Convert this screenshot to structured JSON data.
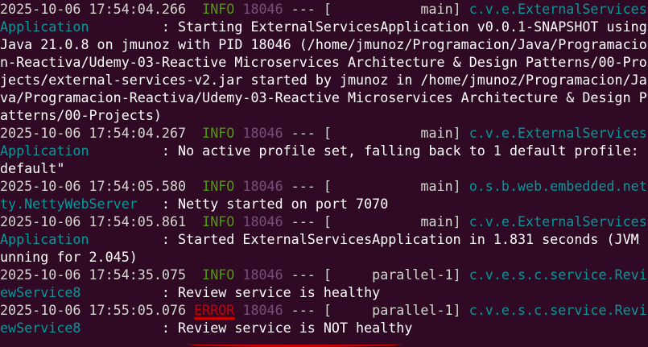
{
  "terminal": {
    "lines": [
      {
        "segments": [
          {
            "cls": "ts",
            "text": "2025-10-06 17:54:04.266  "
          },
          {
            "cls": "lvl-info",
            "text": "INFO "
          },
          {
            "cls": "pid",
            "text": "18046"
          },
          {
            "cls": "dim",
            "text": " --- [           "
          },
          {
            "cls": "thread",
            "text": "main] "
          },
          {
            "cls": "logger",
            "text": "c.v.e.ExternalServices"
          }
        ]
      },
      {
        "segments": [
          {
            "cls": "logger",
            "text": "Application        "
          },
          {
            "cls": "msg",
            "text": " : Starting ExternalServicesApplication v0.0.1-SNAPSHOT using"
          }
        ]
      },
      {
        "segments": [
          {
            "cls": "msg",
            "text": "Java 21.0.8 on jmunoz with PID 18046 (/home/jmunoz/Programacion/Java/Programacio"
          }
        ]
      },
      {
        "segments": [
          {
            "cls": "msg",
            "text": "n-Reactiva/Udemy-03-Reactive Microservices Architecture & Design Patterns/00-Pro"
          }
        ]
      },
      {
        "segments": [
          {
            "cls": "msg",
            "text": "jects/external-services-v2.jar started by jmunoz in /home/jmunoz/Programacion/Ja"
          }
        ]
      },
      {
        "segments": [
          {
            "cls": "msg",
            "text": "va/Programacion-Reactiva/Udemy-03-Reactive Microservices Architecture & Design P"
          }
        ]
      },
      {
        "segments": [
          {
            "cls": "msg",
            "text": "atterns/00-Projects)"
          }
        ]
      },
      {
        "segments": [
          {
            "cls": "ts",
            "text": "2025-10-06 17:54:04.267  "
          },
          {
            "cls": "lvl-info",
            "text": "INFO "
          },
          {
            "cls": "pid",
            "text": "18046"
          },
          {
            "cls": "dim",
            "text": " --- [           "
          },
          {
            "cls": "thread",
            "text": "main] "
          },
          {
            "cls": "logger",
            "text": "c.v.e.ExternalServices"
          }
        ]
      },
      {
        "segments": [
          {
            "cls": "logger",
            "text": "Application        "
          },
          {
            "cls": "msg",
            "text": " : No active profile set, falling back to 1 default profile: \""
          }
        ]
      },
      {
        "segments": [
          {
            "cls": "msg",
            "text": "default\""
          }
        ]
      },
      {
        "segments": [
          {
            "cls": "ts",
            "text": "2025-10-06 17:54:05.580  "
          },
          {
            "cls": "lvl-info",
            "text": "INFO "
          },
          {
            "cls": "pid",
            "text": "18046"
          },
          {
            "cls": "dim",
            "text": " --- [           "
          },
          {
            "cls": "thread",
            "text": "main] "
          },
          {
            "cls": "logger",
            "text": "o.s.b.web.embedded.net"
          }
        ]
      },
      {
        "segments": [
          {
            "cls": "logger",
            "text": "ty.NettyWebServer  "
          },
          {
            "cls": "msg",
            "text": " : Netty started on port 7070"
          }
        ]
      },
      {
        "segments": [
          {
            "cls": "ts",
            "text": "2025-10-06 17:54:05.861  "
          },
          {
            "cls": "lvl-info",
            "text": "INFO "
          },
          {
            "cls": "pid",
            "text": "18046"
          },
          {
            "cls": "dim",
            "text": " --- [           "
          },
          {
            "cls": "thread",
            "text": "main] "
          },
          {
            "cls": "logger",
            "text": "c.v.e.ExternalServices"
          }
        ]
      },
      {
        "segments": [
          {
            "cls": "logger",
            "text": "Application        "
          },
          {
            "cls": "msg",
            "text": " : Started ExternalServicesApplication in 1.831 seconds (JVM r"
          }
        ]
      },
      {
        "segments": [
          {
            "cls": "msg",
            "text": "unning for 2.045)"
          }
        ]
      },
      {
        "segments": [
          {
            "cls": "ts",
            "text": "2025-10-06 17:54:35.075  "
          },
          {
            "cls": "lvl-info",
            "text": "INFO "
          },
          {
            "cls": "pid",
            "text": "18046"
          },
          {
            "cls": "dim",
            "text": " --- [     "
          },
          {
            "cls": "thread",
            "text": "parallel-1] "
          },
          {
            "cls": "logger",
            "text": "c.v.e.s.c.service.Revi"
          }
        ]
      },
      {
        "segments": [
          {
            "cls": "logger",
            "text": "ewService8         "
          },
          {
            "cls": "msg",
            "text": " : Review service is healthy"
          }
        ]
      },
      {
        "segments": [
          {
            "cls": "ts",
            "text": "2025-10-06 17:55:05.076 "
          },
          {
            "cls": "lvl-error underline-red",
            "text": "ERROR"
          },
          {
            "cls": "dim",
            "text": " "
          },
          {
            "cls": "pid",
            "text": "18046"
          },
          {
            "cls": "dim",
            "text": " --- [     "
          },
          {
            "cls": "thread",
            "text": "parallel-1] "
          },
          {
            "cls": "logger",
            "text": "c.v.e.s.c.service.Revi"
          }
        ]
      },
      {
        "segments": [
          {
            "cls": "logger",
            "text": "ewService8         "
          },
          {
            "cls": "msg",
            "text": " : Review service is NOT healthy"
          }
        ]
      }
    ]
  }
}
